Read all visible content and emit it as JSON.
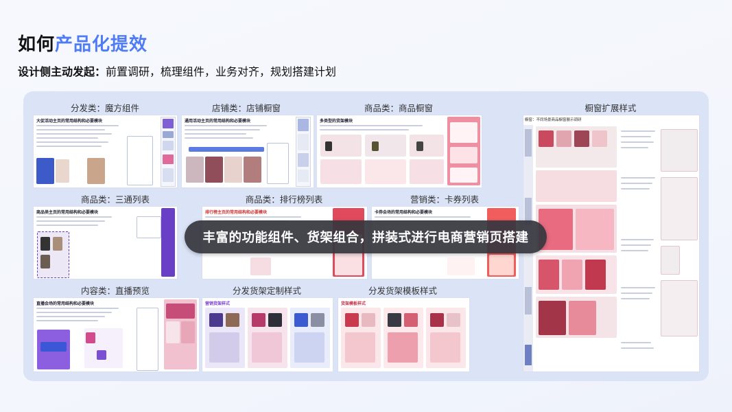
{
  "header": {
    "title_plain": "如何",
    "title_accent": "产品化提效",
    "subtitle_lead": "设计侧主动发起：",
    "subtitle_rest": "前置调研，梳理组件，业务对齐，规划搭建计划"
  },
  "sections": {
    "s1": "分发类：魔方组件",
    "s2": "店铺类：店铺橱窗",
    "s3": "商品类：商品橱窗",
    "s4": "橱窗扩展样式",
    "s5": "商品类：三通列表",
    "s6": "商品类：排行榜列表",
    "s7": "营销类：卡券列表",
    "s8": "内容类：直播预览",
    "s9": "分发货架定制样式",
    "s10": "分发货架模板样式"
  },
  "banner": "丰富的功能组件、货架组合，拼装式进行电商营销页搭建",
  "thumb_titles": {
    "t1": "大促活动主页的常用结构和必要模块",
    "t2": "通用活动主页的常用结构和必要模块",
    "t3": "多类型的货架模块",
    "t5": "商品类主页的常用结构和必要模块",
    "t6": "排行榜主页的常用结构和必要模块",
    "t7": "卡券会场的常用结构和必要模块",
    "t8": "直播会场的常用结构和必要模块",
    "t9": "营销货架样式",
    "t10": "货架模板样式",
    "big": "橱窗：不同场景商品橱窗展示调研"
  },
  "colors": {
    "accent": "#4f7cf5",
    "panel": "#dbe4f7",
    "banner_bg": "#37373e",
    "product_red": "#e04a5c",
    "product_purple": "#6a3fc7"
  }
}
